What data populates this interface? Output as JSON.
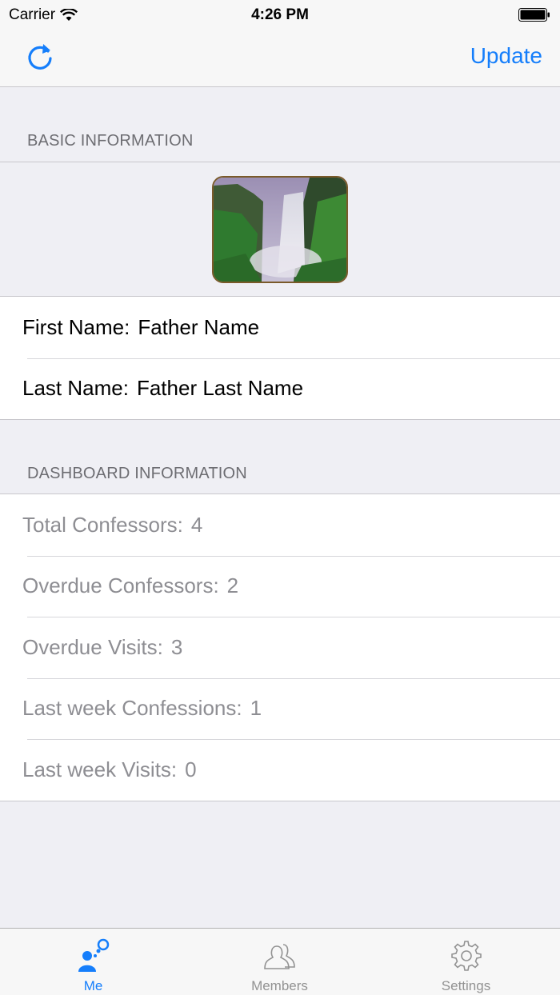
{
  "status_bar": {
    "carrier": "Carrier",
    "time": "4:26 PM"
  },
  "nav_bar": {
    "update_label": "Update"
  },
  "basic_info": {
    "header": "BASIC INFORMATION",
    "first_name_label": "First Name:",
    "first_name_value": "Father Name",
    "last_name_label": "Last Name:",
    "last_name_value": "Father Last Name"
  },
  "dashboard": {
    "header": "DASHBOARD INFORMATION",
    "rows": [
      {
        "label": "Total Confessors:",
        "value": "4"
      },
      {
        "label": "Overdue Confessors:",
        "value": "2"
      },
      {
        "label": "Overdue Visits:",
        "value": "3"
      },
      {
        "label": "Last week Confessions:",
        "value": "1"
      },
      {
        "label": "Last week Visits:",
        "value": "0"
      }
    ]
  },
  "tab_bar": {
    "tabs": [
      {
        "label": "Me",
        "icon": "me-icon",
        "active": true
      },
      {
        "label": "Members",
        "icon": "members-icon",
        "active": false
      },
      {
        "label": "Settings",
        "icon": "gear-icon",
        "active": false
      }
    ]
  },
  "colors": {
    "accent": "#157efb",
    "background": "#efeff4",
    "inactive": "#929292"
  }
}
